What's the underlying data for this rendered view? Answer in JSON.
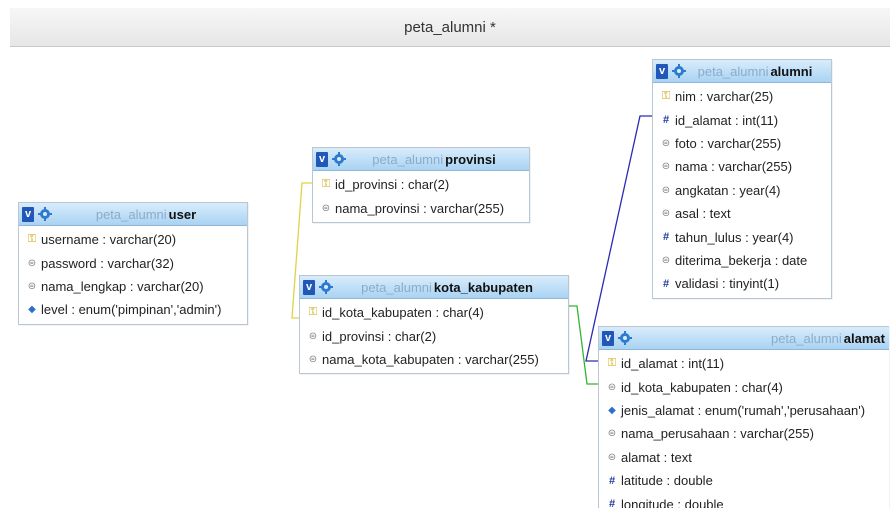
{
  "window": {
    "title": "peta_alumni *"
  },
  "colors": {
    "header_top": "#d9ecfb",
    "header_bottom": "#a9d3f3",
    "link_yellow": "#e0d24a",
    "link_green": "#33b533",
    "link_blue": "#2a2ab5"
  },
  "tables": {
    "user": {
      "db": "peta_alumni",
      "name": "user",
      "columns": [
        {
          "icon": "key-icon",
          "text": "username : varchar(20)"
        },
        {
          "icon": "text-field-icon",
          "text": "password : varchar(32)"
        },
        {
          "icon": "text-field-icon",
          "text": "nama_lengkap : varchar(20)"
        },
        {
          "icon": "enum-icon",
          "text": "level : enum('pimpinan','admin')"
        }
      ]
    },
    "provinsi": {
      "db": "peta_alumni",
      "name": "provinsi",
      "columns": [
        {
          "icon": "key-icon",
          "text": "id_provinsi : char(2)"
        },
        {
          "icon": "text-field-icon",
          "text": "nama_provinsi : varchar(255)"
        }
      ]
    },
    "kota_kabupaten": {
      "db": "peta_alumni",
      "name": "kota_kabupaten",
      "columns": [
        {
          "icon": "key-icon",
          "text": "id_kota_kabupaten : char(4)"
        },
        {
          "icon": "text-field-icon",
          "text": "id_provinsi : char(2)"
        },
        {
          "icon": "text-field-icon",
          "text": "nama_kota_kabupaten : varchar(255)"
        }
      ]
    },
    "alumni": {
      "db": "peta_alumni",
      "name": "alumni",
      "columns": [
        {
          "icon": "key-icon",
          "text": "nim : varchar(25)"
        },
        {
          "icon": "number-icon",
          "text": "id_alamat : int(11)"
        },
        {
          "icon": "text-field-icon",
          "text": "foto : varchar(255)"
        },
        {
          "icon": "text-field-icon",
          "text": "nama : varchar(255)"
        },
        {
          "icon": "text-field-icon",
          "text": "angkatan : year(4)"
        },
        {
          "icon": "text-field-icon",
          "text": "asal : text"
        },
        {
          "icon": "number-icon",
          "text": "tahun_lulus : year(4)"
        },
        {
          "icon": "text-field-icon",
          "text": "diterima_bekerja : date"
        },
        {
          "icon": "number-icon",
          "text": "validasi : tinyint(1)"
        }
      ]
    },
    "alamat": {
      "db": "peta_alumni",
      "name": "alamat",
      "columns": [
        {
          "icon": "key-icon",
          "text": "id_alamat : int(11)"
        },
        {
          "icon": "text-field-icon",
          "text": "id_kota_kabupaten : char(4)"
        },
        {
          "icon": "enum-icon",
          "text": "jenis_alamat : enum('rumah','perusahaan')"
        },
        {
          "icon": "text-field-icon",
          "text": "nama_perusahaan : varchar(255)"
        },
        {
          "icon": "text-field-icon",
          "text": "alamat : text"
        },
        {
          "icon": "number-icon",
          "text": "latitude : double"
        },
        {
          "icon": "number-icon",
          "text": "longitude : double"
        }
      ]
    }
  }
}
